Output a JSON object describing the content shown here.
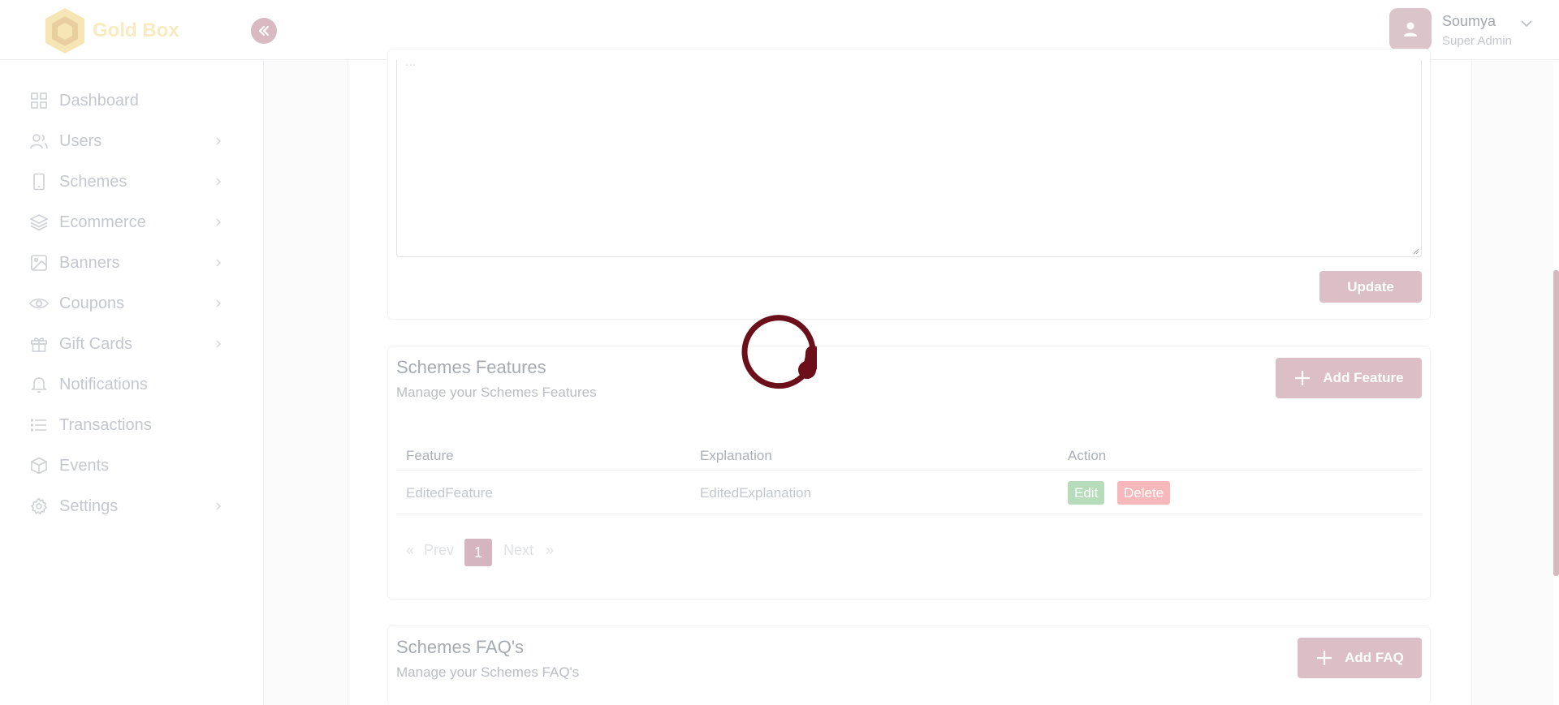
{
  "brand": {
    "name": "Gold Box"
  },
  "user": {
    "name": "Soumya",
    "role": "Super Admin"
  },
  "sidebar": {
    "items": [
      {
        "label": "Dashboard",
        "icon": "grid-icon",
        "has_submenu": false
      },
      {
        "label": "Users",
        "icon": "users-icon",
        "has_submenu": true
      },
      {
        "label": "Schemes",
        "icon": "tablet-icon",
        "has_submenu": true
      },
      {
        "label": "Ecommerce",
        "icon": "layers-icon",
        "has_submenu": true
      },
      {
        "label": "Banners",
        "icon": "image-icon",
        "has_submenu": true
      },
      {
        "label": "Coupons",
        "icon": "eye-icon",
        "has_submenu": true
      },
      {
        "label": "Gift Cards",
        "icon": "gift-icon",
        "has_submenu": true
      },
      {
        "label": "Notifications",
        "icon": "bell-icon",
        "has_submenu": false
      },
      {
        "label": "Transactions",
        "icon": "list-icon",
        "has_submenu": false
      },
      {
        "label": "Events",
        "icon": "box-icon",
        "has_submenu": false
      },
      {
        "label": "Settings",
        "icon": "gear-icon",
        "has_submenu": true
      }
    ]
  },
  "description_card": {
    "update_label": "Update"
  },
  "features": {
    "title": "Schemes Features",
    "subtitle": "Manage your Schemes Features",
    "add_label": "Add Feature",
    "columns": [
      "Feature",
      "Explanation",
      "Action"
    ],
    "rows": [
      {
        "feature": "EditedFeature",
        "explanation": "EditedExplanation",
        "edit_label": "Edit",
        "delete_label": "Delete"
      }
    ],
    "pagination": {
      "first": "«",
      "prev": "Prev",
      "current": "1",
      "next": "Next",
      "last": "»"
    }
  },
  "faqs": {
    "title": "Schemes FAQ's",
    "subtitle": "Manage your Schemes FAQ's",
    "add_label": "Add FAQ"
  },
  "colors": {
    "accent": "#dbbec6",
    "spinner": "#6b0f1a",
    "edit_badge": "#b6dcbc",
    "delete_badge": "#f6b8bb"
  }
}
